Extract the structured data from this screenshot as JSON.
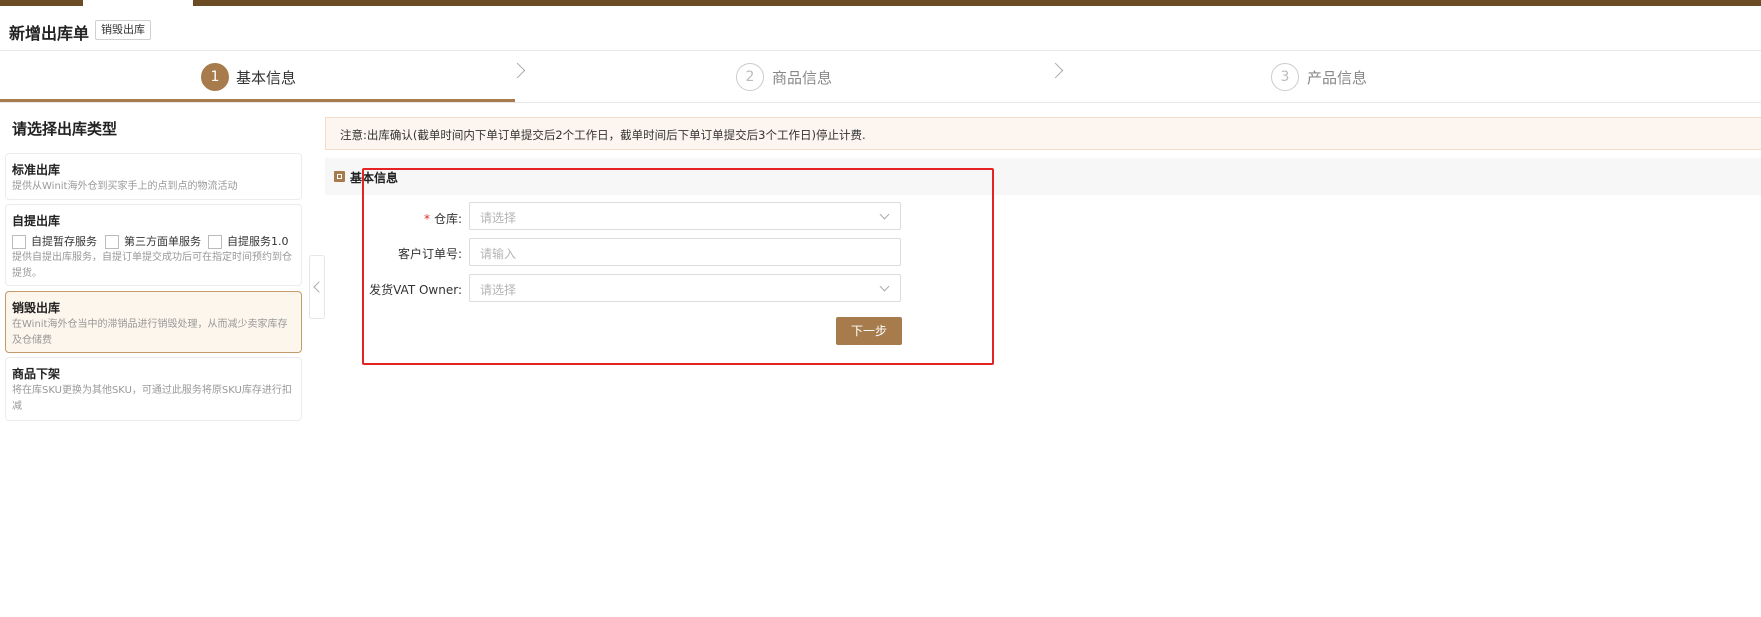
{
  "page": {
    "title": "新增出库单",
    "type_tag": "销毁出库"
  },
  "steps": [
    {
      "number": "1",
      "label": "基本信息",
      "active": true
    },
    {
      "number": "2",
      "label": "商品信息",
      "active": false
    },
    {
      "number": "3",
      "label": "产品信息",
      "active": false
    }
  ],
  "left_panel": {
    "title": "请选择出库类型",
    "options": [
      {
        "title": "标准出库",
        "desc": "提供从Winit海外仓到买家手上的点到点的物流活动"
      },
      {
        "title": "自提出库",
        "checkboxes": [
          "自提暂存服务",
          "第三方面单服务",
          "自提服务1.0"
        ],
        "desc": "提供自提出库服务，自提订单提交成功后可在指定时间预约到仓提货。"
      },
      {
        "title": "销毁出库",
        "desc": "在Winit海外仓当中的滞销品进行销毁处理，从而减少卖家库存及仓储费",
        "selected": true
      },
      {
        "title": "商品下架",
        "desc": "将在库SKU更换为其他SKU，可通过此服务将原SKU库存进行扣减"
      }
    ]
  },
  "notice": "注意:出库确认(截单时间内下单订单提交后2个工作日，截单时间后下单订单提交后3个工作日)停止计费.",
  "section": {
    "title": "基本信息"
  },
  "form": {
    "warehouse": {
      "required_mark": "*",
      "label": "仓库:",
      "placeholder": "请选择"
    },
    "customer_order": {
      "label": "客户订单号:",
      "placeholder": "请输入"
    },
    "vat_owner": {
      "label": "发货VAT Owner:",
      "placeholder": "请选择"
    },
    "next_label": "下一步"
  },
  "colors": {
    "accent": "#a77b4c",
    "topbar": "#6b4c25",
    "highlight": "#e52323"
  }
}
